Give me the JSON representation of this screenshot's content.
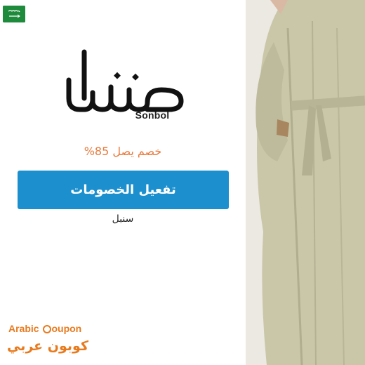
{
  "country": {
    "flag_icon": "saudi-flag-icon",
    "flag_color": "#1e8a3c"
  },
  "brand": {
    "latin_name": "Sonbol"
  },
  "offer": {
    "discount_text": "خصم يصل 85%",
    "discount_color": "#e87a3c",
    "button_label": "تفعيل الخصومات",
    "button_color": "#1c8fce",
    "store_name": "سنبل"
  },
  "site": {
    "logo_en_prefix": "Arabic ",
    "logo_en_c": "C",
    "logo_en_suffix": "oupon",
    "logo_ar": "كوبون عربي",
    "logo_color": "#e87a1e"
  },
  "product": {
    "image": "green-abaya-model-photo"
  }
}
